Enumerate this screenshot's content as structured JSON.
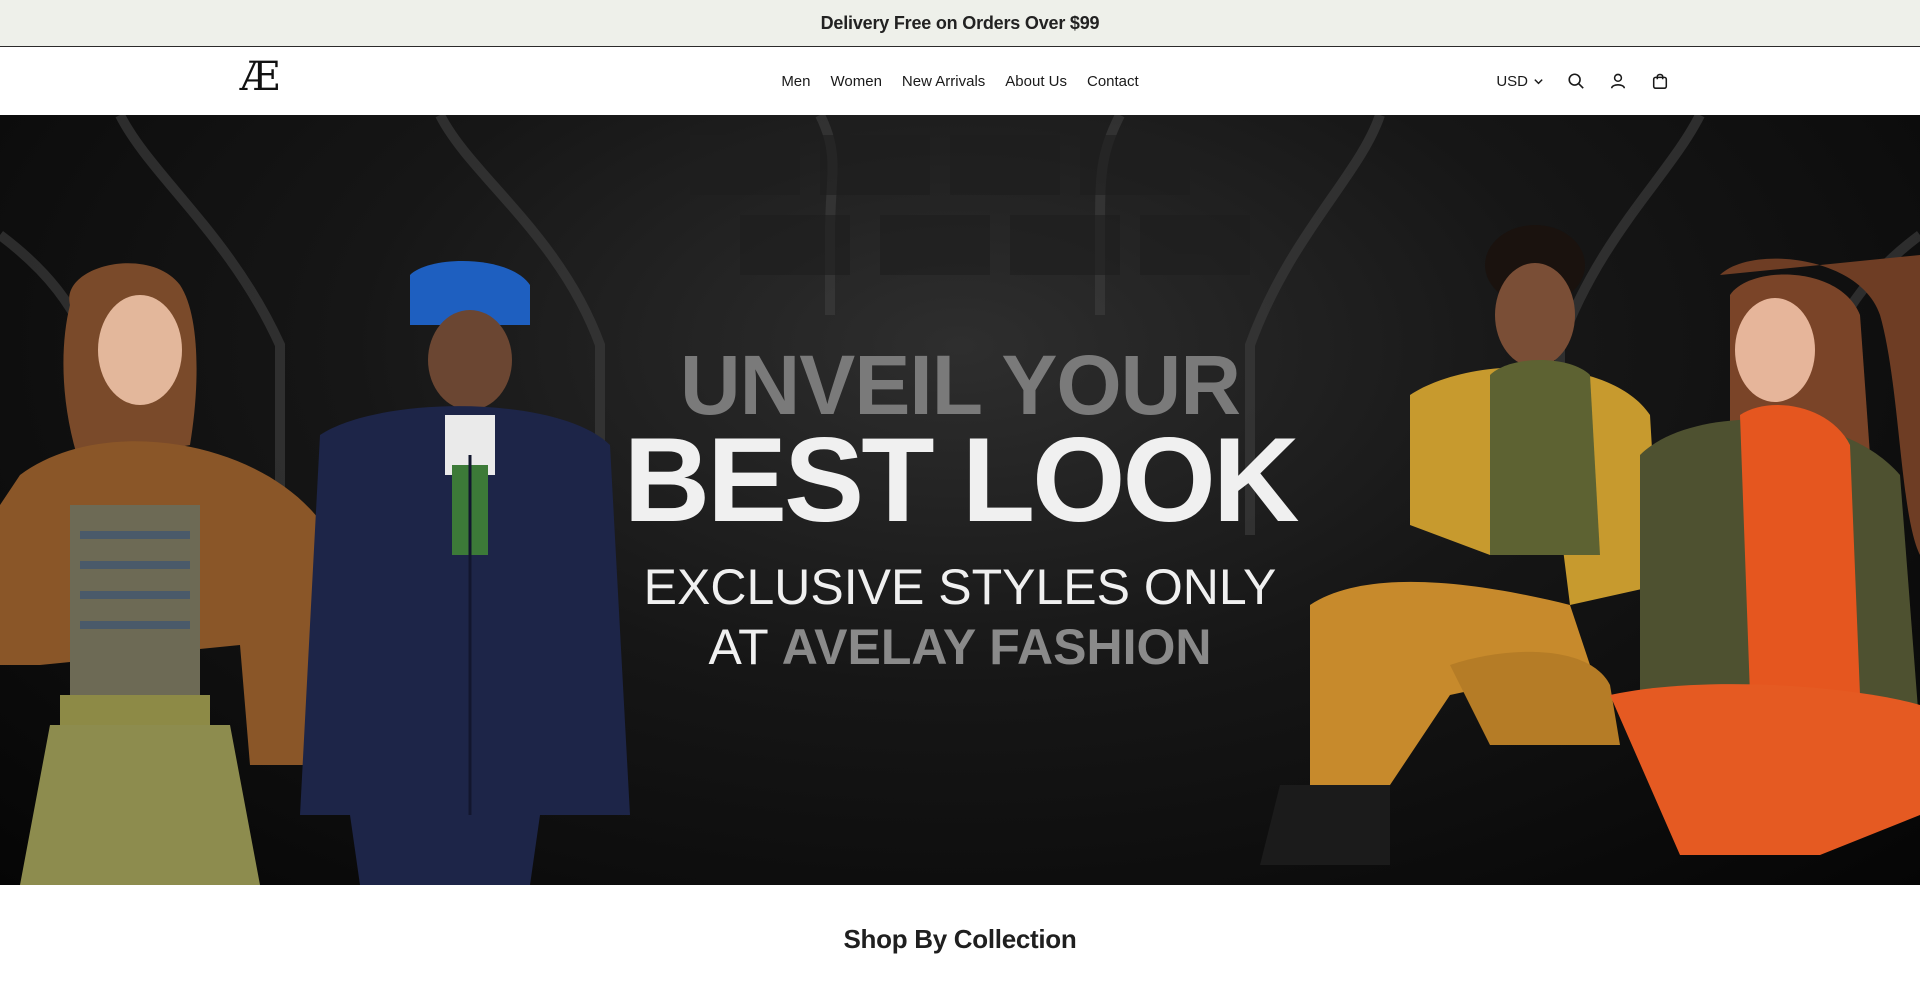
{
  "announcement": {
    "text": "Delivery Free on Orders Over $99"
  },
  "logo": {
    "text": "Æ"
  },
  "nav": {
    "items": [
      "Men",
      "Women",
      "New Arrivals",
      "About Us",
      "Contact"
    ]
  },
  "tools": {
    "currency": "USD"
  },
  "hero": {
    "line1": "UNVEIL YOUR",
    "line2": "BEST LOOK",
    "line3": "EXCLUSIVE STYLES ONLY",
    "line4_prefix": "AT",
    "line4_brand": "AVELAY FASHION"
  },
  "section": {
    "title": "Shop By Collection"
  },
  "colors": {
    "announce_bg": "#eef0ea",
    "hero_bg": "#0a0a0a",
    "accent_gray": "#8a8a8a"
  }
}
